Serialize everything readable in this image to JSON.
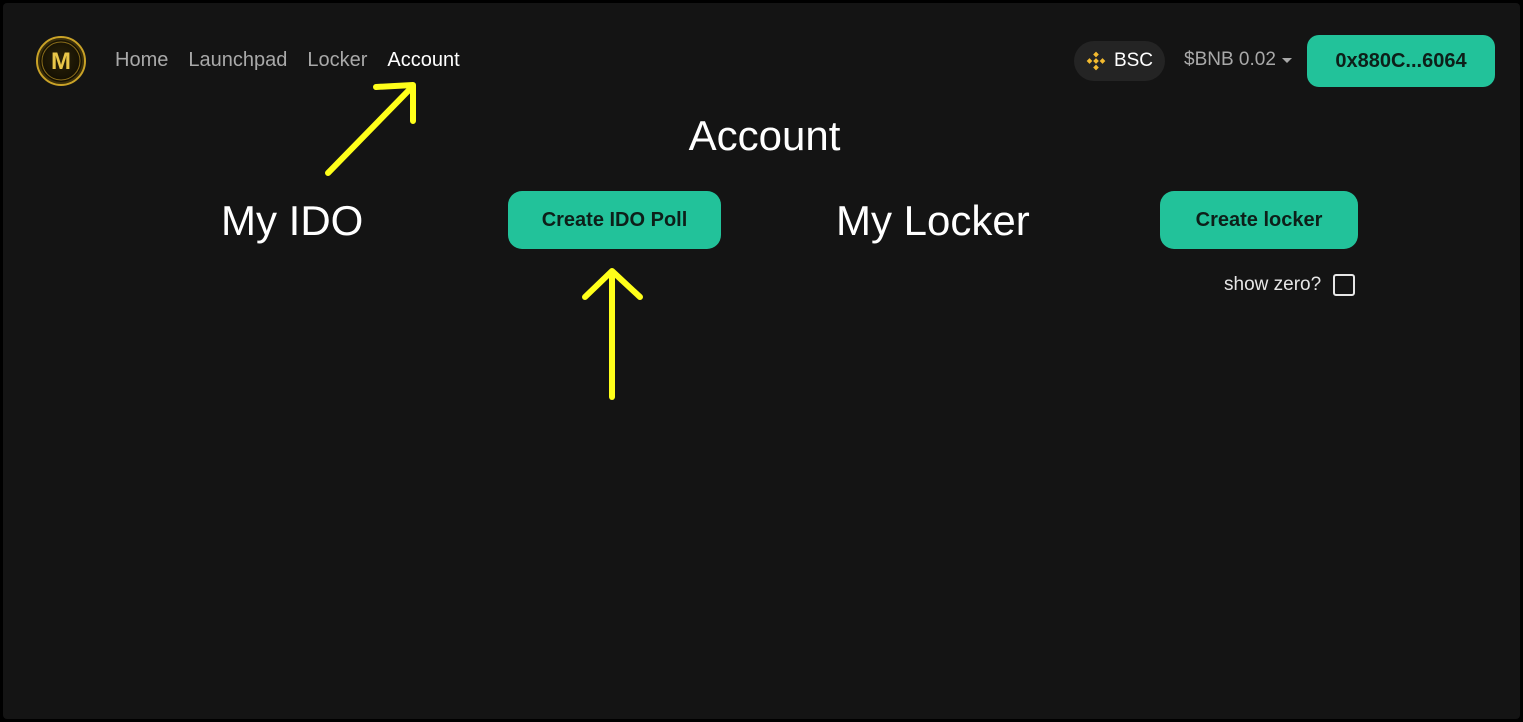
{
  "header": {
    "nav": [
      {
        "label": "Home",
        "active": false
      },
      {
        "label": "Launchpad",
        "active": false
      },
      {
        "label": "Locker",
        "active": false
      },
      {
        "label": "Account",
        "active": true
      }
    ],
    "network_label": "BSC",
    "balance_label": "$BNB 0.02",
    "wallet_label": "0x880C...6064",
    "network_icon": "bnb-chain-icon",
    "logo_letter": "M"
  },
  "main": {
    "title": "Account",
    "my_ido_title": "My IDO",
    "create_ido_label": "Create IDO Poll",
    "my_locker_title": "My Locker",
    "create_locker_label": "Create locker",
    "show_zero_label": "show zero?",
    "show_zero_checked": false
  },
  "colors": {
    "accent": "#22c29a",
    "background": "#141414",
    "annotation": "#ffff1a",
    "bnb": "#f3ba2f"
  }
}
